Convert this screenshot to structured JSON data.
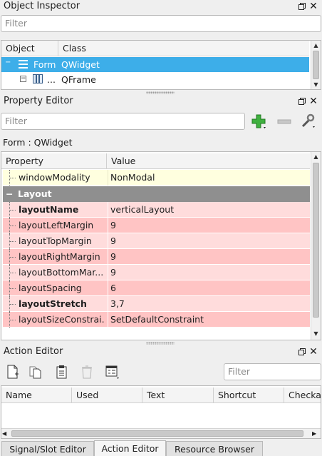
{
  "object_inspector": {
    "title": "Object Inspector",
    "filter_placeholder": "Filter",
    "columns": [
      "Object",
      "Class"
    ],
    "rows": [
      {
        "object": "Form",
        "class": "QWidget",
        "selected": true
      },
      {
        "object": "...",
        "class": "QFrame",
        "selected": false
      }
    ]
  },
  "property_editor": {
    "title": "Property Editor",
    "filter_placeholder": "Filter",
    "context": "Form : QWidget",
    "columns": [
      "Property",
      "Value"
    ],
    "rows": [
      {
        "name": "windowModality",
        "value": "NonModal",
        "bold": false
      },
      {
        "name": "layoutName",
        "value": "verticalLayout",
        "bold": true
      },
      {
        "name": "layoutLeftMargin",
        "value": "9",
        "bold": false
      },
      {
        "name": "layoutTopMargin",
        "value": "9",
        "bold": false
      },
      {
        "name": "layoutRightMargin",
        "value": "9",
        "bold": false
      },
      {
        "name": "layoutBottomMar...",
        "value": "9",
        "bold": false
      },
      {
        "name": "layoutSpacing",
        "value": "6",
        "bold": false
      },
      {
        "name": "layoutStretch",
        "value": "3,7",
        "bold": true
      },
      {
        "name": "layoutSizeConstrai...",
        "value": "SetDefaultConstraint",
        "bold": false
      }
    ],
    "group_label": "Layout",
    "colors": {
      "category": "#8f8f8f",
      "yellow_row": "#ffffdf",
      "pink_light": "#ffdcdc",
      "pink_dark": "#ffc4c4",
      "selection": "#3daee9"
    }
  },
  "action_editor": {
    "title": "Action Editor",
    "filter_placeholder": "Filter",
    "columns": [
      "Name",
      "Used",
      "Text",
      "Shortcut",
      "Checka"
    ]
  },
  "tabs": [
    "Signal/Slot Editor",
    "Action Editor",
    "Resource Browser"
  ],
  "active_tab": "Action Editor",
  "icons": {
    "float": "float-icon",
    "close": "close-icon",
    "add": "plus-icon",
    "remove": "minus-icon",
    "configure": "wrench-icon"
  },
  "close_glyph": "✕"
}
